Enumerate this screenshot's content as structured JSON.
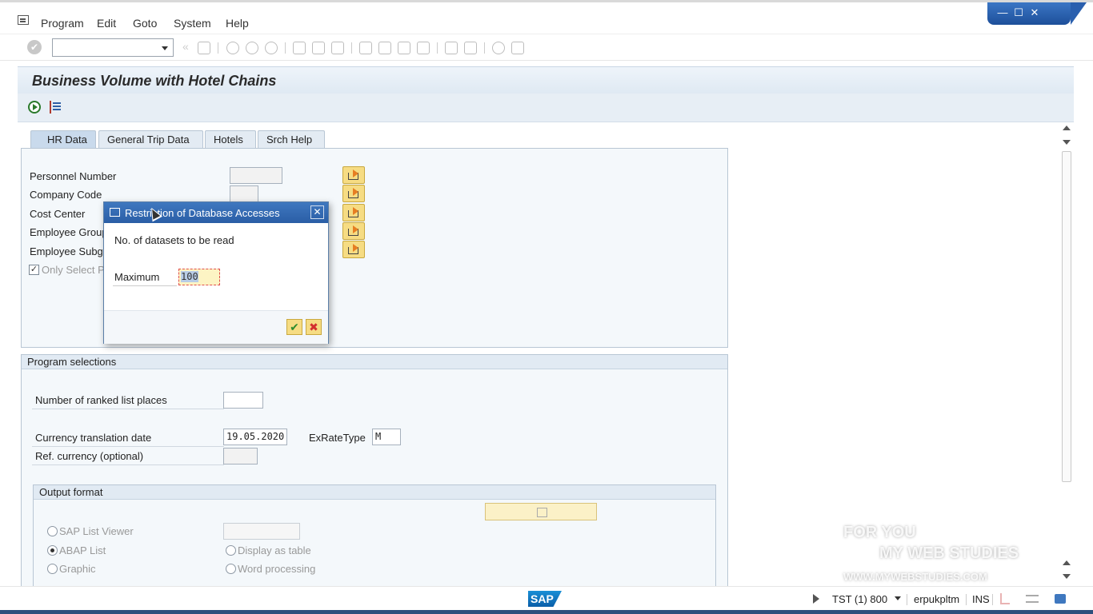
{
  "menu": {
    "items": [
      "Program",
      "Edit",
      "Goto",
      "System",
      "Help"
    ]
  },
  "window_controls": {
    "minimize": "—",
    "maximize": "☐",
    "close": "✕"
  },
  "toolbar": {
    "command_field_value": ""
  },
  "screen": {
    "title": "Business Volume with Hotel Chains"
  },
  "tabs": [
    {
      "label": "HR Data",
      "active": true
    },
    {
      "label": "General Trip Data",
      "active": false
    },
    {
      "label": "Hotels",
      "active": false
    },
    {
      "label": "Srch Help",
      "active": false
    }
  ],
  "hr_data": {
    "fields": [
      {
        "label": "Personnel Number",
        "value": ""
      },
      {
        "label": "Company Code",
        "value": ""
      },
      {
        "label": "Cost Center",
        "value": ""
      },
      {
        "label": "Employee Group",
        "value": ""
      },
      {
        "label": "Employee Subgr",
        "value": ""
      }
    ],
    "only_select_label": "Only Select P",
    "only_select_checked": true
  },
  "program_selections": {
    "title": "Program selections",
    "ranked_places_label": "Number of ranked list places",
    "ranked_places_value": "",
    "currency_date_label": "Currency translation date",
    "currency_date_value": "19.05.2020",
    "exrate_label": "ExRateType",
    "exrate_value": "M",
    "ref_currency_label": "Ref. currency (optional)",
    "ref_currency_value": ""
  },
  "output_format": {
    "title": "Output format",
    "options_left": [
      {
        "label": "SAP List Viewer",
        "selected": false
      },
      {
        "label": "ABAP List",
        "selected": true
      },
      {
        "label": "Graphic",
        "selected": false
      }
    ],
    "options_right": [
      {
        "label": "Display as table",
        "selected": false
      },
      {
        "label": "Word processing",
        "selected": false
      }
    ]
  },
  "dialog": {
    "title": "Restriction of Database Accesses",
    "text": "No. of datasets to be read",
    "maximum_label": "Maximum",
    "maximum_value": "100"
  },
  "status": {
    "logo": "SAP",
    "system": "TST (1) 800",
    "user": "erpukpltm",
    "mode": "INS"
  },
  "watermark": {
    "line1": "FOR YOU",
    "line2": "MY WEB STUDIES",
    "line3": "WWW.MYWEBSTUDIES.COM"
  }
}
